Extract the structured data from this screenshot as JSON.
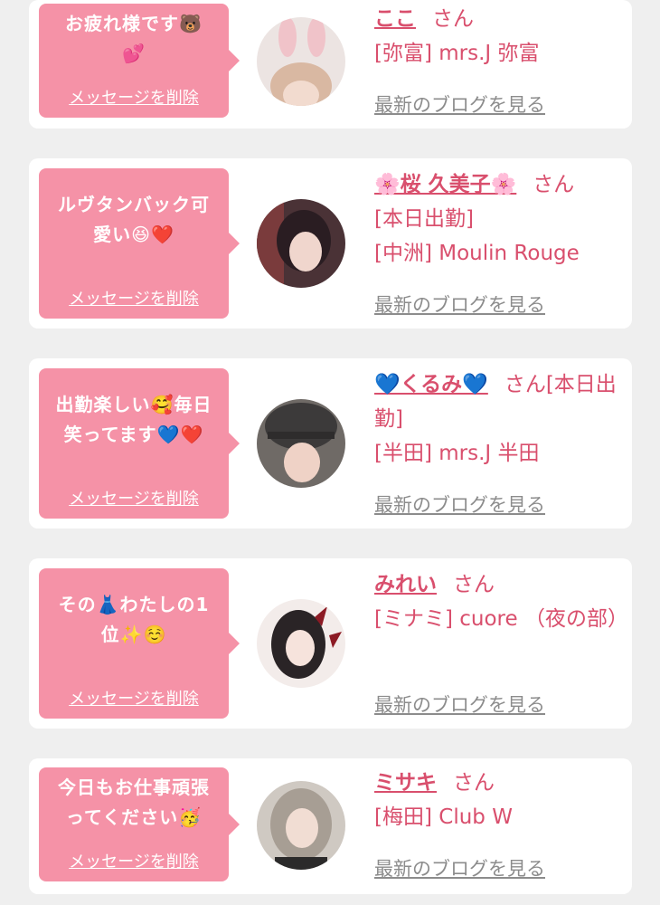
{
  "delete_label": "メッセージを削除",
  "blog_label": "最新のブログを見る",
  "san_label": "さん",
  "items": [
    {
      "message": "お疲れ様です🐻\n💕",
      "name": "ここ",
      "suffix": "さん",
      "details": [
        "[弥富] mrs.J 弥富"
      ]
    },
    {
      "message": "ルヴタンバック可\n愛い😆❤️",
      "name": "🌸桜 久美子🌸",
      "suffix": "さん",
      "details": [
        "[本日出勤]",
        "[中洲] Moulin Rouge"
      ]
    },
    {
      "message": "出勤楽しい🥰毎日\n笑ってます💙❤️",
      "name": "💙くるみ💙",
      "suffix": "さん[本日出勤]",
      "details": [
        "[半田] mrs.J 半田"
      ]
    },
    {
      "message": "その👗わたしの1\n位✨☺️",
      "name": "みれい",
      "suffix": "さん",
      "details": [
        "[ミナミ] cuore （夜の部）"
      ]
    },
    {
      "message": "今日もお仕事頑張\nってください🥳",
      "name": "ミサキ",
      "suffix": "さん",
      "details": [
        "[梅田] Club W"
      ]
    }
  ]
}
